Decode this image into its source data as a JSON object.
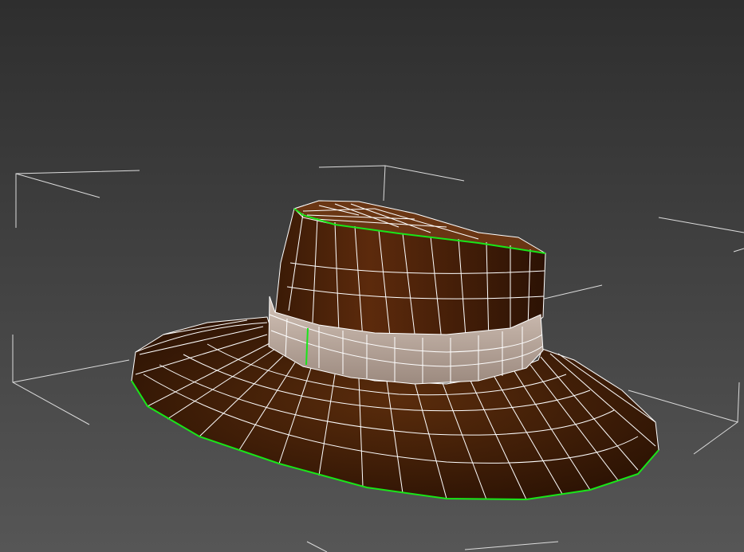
{
  "viewport": {
    "background_top": "#2e2e2e",
    "background_bottom": "#565656",
    "wireframe_color": "#ffffff",
    "selection_color": "#19e619",
    "bbox_color": "#dcdcdc"
  },
  "hat_model": {
    "icon": "hat-model-icon",
    "brim_color": "#3f1e08",
    "crown_color": "#4a2208",
    "band_color": "#b8a59a"
  }
}
